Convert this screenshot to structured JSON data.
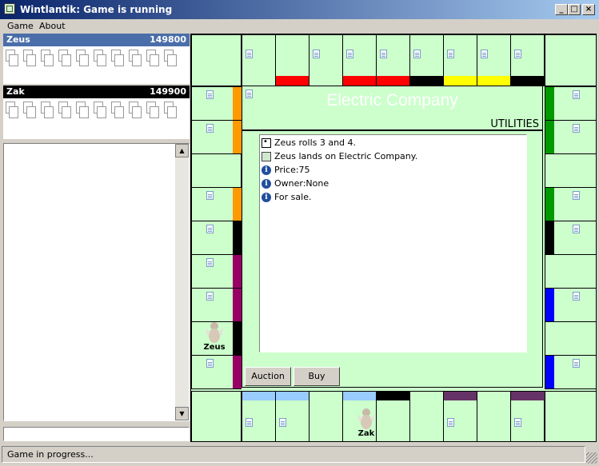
{
  "window": {
    "title": "Wintlantik: Game is running",
    "controls": [
      "_",
      "□",
      "×"
    ]
  },
  "menu": [
    "Game",
    "About"
  ],
  "players": [
    {
      "name": "Zeus",
      "money": "149800",
      "header_bg": "#4a6ea9"
    },
    {
      "name": "Zak",
      "money": "149900",
      "header_bg": "#000000"
    }
  ],
  "property_popup": {
    "name": "Electric Company",
    "group": "UTILITIES",
    "log": [
      {
        "icon": "dice-icon",
        "text": "Zeus rolls 3 and 4."
      },
      {
        "icon": "board-icon",
        "text": "Zeus lands on Electric Company."
      },
      {
        "icon": "info-icon",
        "text": "Price:75"
      },
      {
        "icon": "info-icon",
        "text": "Owner:None"
      },
      {
        "icon": "info-icon",
        "text": "For sale."
      }
    ],
    "buttons": {
      "auction": "Auction",
      "buy": "Buy"
    }
  },
  "tokens": {
    "zeus": "Zeus",
    "zak": "Zak"
  },
  "status": "Game in progress...",
  "colors": {
    "board_bg": "#ccffcc",
    "red": "#ff0000",
    "yellow": "#ffff00",
    "black": "#000000",
    "orange": "#ff9900",
    "purple": "#990066",
    "green": "#009900",
    "blue": "#0000ff",
    "lightblue": "#99ccff",
    "plum": "#663366"
  }
}
